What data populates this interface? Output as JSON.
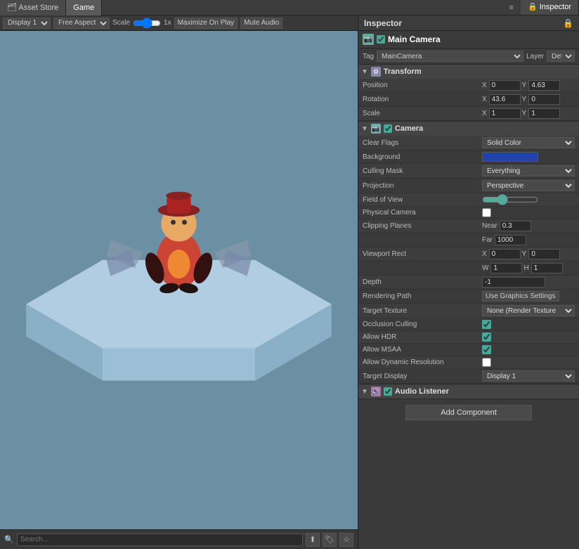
{
  "tabs": {
    "asset_store": {
      "label": "Asset Store",
      "icon": "🗂"
    },
    "game": {
      "label": "Game",
      "active": true
    }
  },
  "game_toolbar": {
    "display": "Display 1",
    "aspect": "Free Aspect",
    "scale_label": "Scale",
    "scale_value": "1x",
    "maximize_btn": "Maximize On Play",
    "mute_btn": "Mute Audio"
  },
  "inspector": {
    "title": "Inspector",
    "object_name": "Main Camera",
    "tag_label": "Tag",
    "tag_value": "MainCamera",
    "layer_label": "Layer",
    "layer_value": "Defau",
    "transform": {
      "name": "Transform",
      "position": {
        "label": "Position",
        "x": "0",
        "y": "4.63"
      },
      "rotation": {
        "label": "Rotation",
        "x": "43.6",
        "y": "0"
      },
      "scale": {
        "label": "Scale",
        "x": "1",
        "y": "1"
      }
    },
    "camera": {
      "name": "Camera",
      "clear_flags": {
        "label": "Clear Flags",
        "value": "Solid Color"
      },
      "background": {
        "label": "Background"
      },
      "culling_mask": {
        "label": "Culling Mask",
        "value": "Everything"
      },
      "projection": {
        "label": "Projection",
        "value": "Perspective"
      },
      "field_of_view": {
        "label": "Field of View"
      },
      "physical_camera": {
        "label": "Physical Camera"
      },
      "clipping_planes": {
        "label": "Clipping Planes",
        "near_label": "Near",
        "near_value": "0.3",
        "far_label": "Far",
        "far_value": "1000"
      },
      "viewport_rect": {
        "label": "Viewport Rect",
        "x": "0",
        "y": "0",
        "w": "1",
        "h": "1"
      },
      "depth": {
        "label": "Depth",
        "value": "-1"
      },
      "rendering_path": {
        "label": "Rendering Path",
        "value": "Use Graphics Settings"
      },
      "target_texture": {
        "label": "Target Texture",
        "value": "None (Render Texture"
      },
      "occlusion_culling": {
        "label": "Occlusion Culling"
      },
      "allow_hdr": {
        "label": "Allow HDR"
      },
      "allow_msaa": {
        "label": "Allow MSAA"
      },
      "allow_dynamic": {
        "label": "Allow Dynamic Resolution"
      },
      "target_display": {
        "label": "Target Display",
        "value": "Display 1"
      }
    },
    "audio_listener": {
      "name": "Audio Listener"
    },
    "add_component": "Add Component"
  },
  "bottom_bar": {
    "search_placeholder": "Search..."
  }
}
